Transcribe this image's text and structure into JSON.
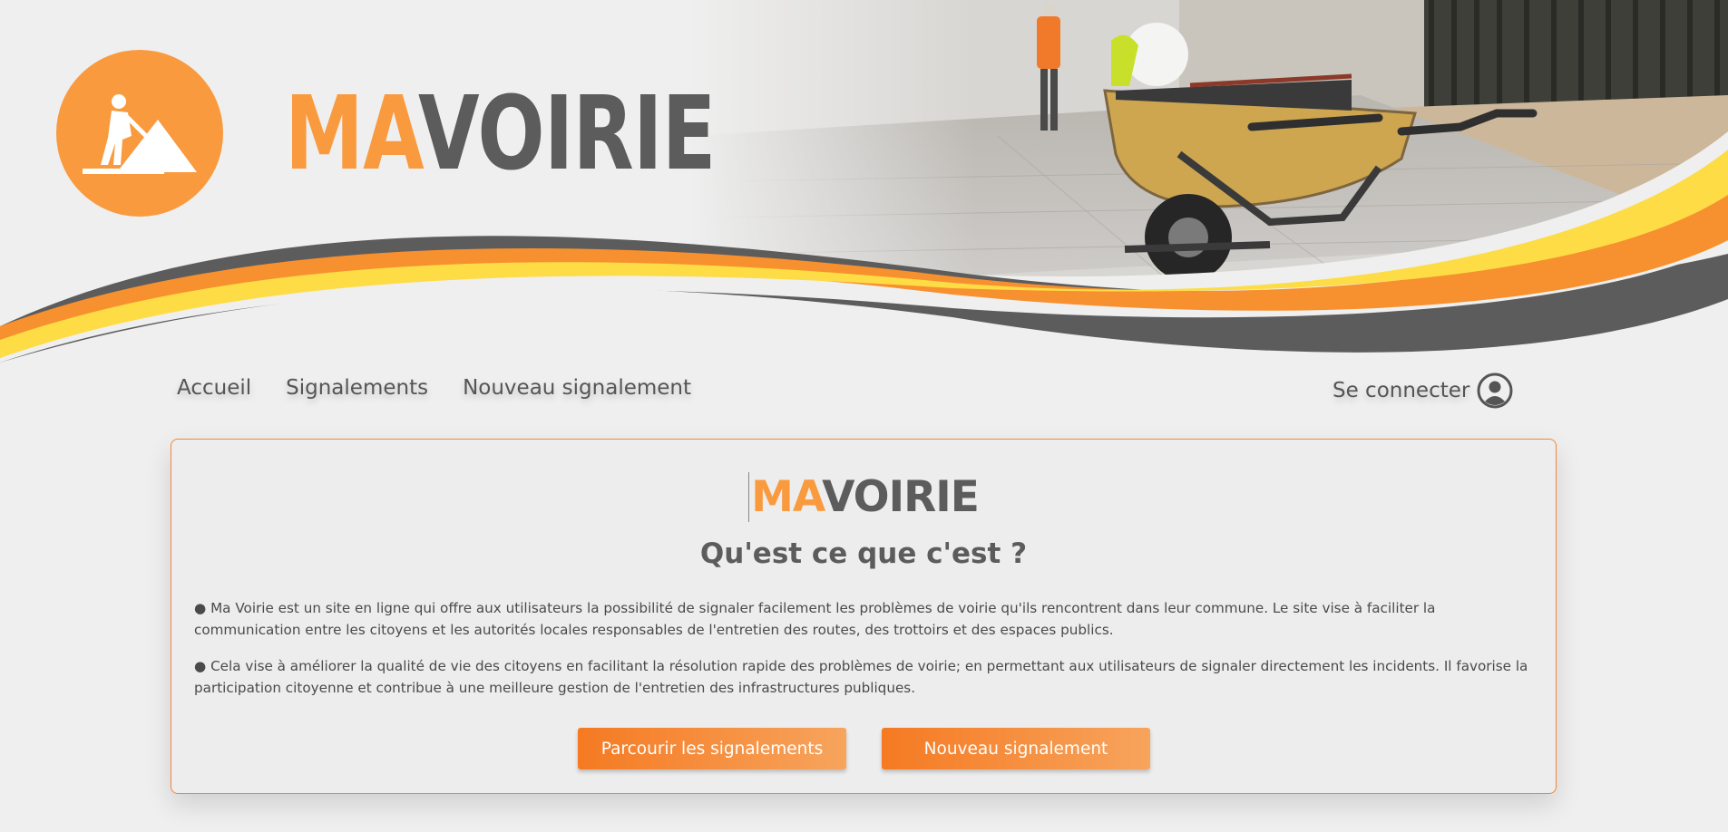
{
  "header": {
    "brand_ma": "MA",
    "brand_voirie": "VOIRIE",
    "logo_icon": "road-worker-icon",
    "hero_image": "wheelbarrow-photo",
    "colors": {
      "orange": "#f99a3e",
      "yellow": "#fddc45",
      "gray": "#5c5c5c"
    }
  },
  "nav": {
    "items": [
      {
        "label": "Accueil"
      },
      {
        "label": "Signalements"
      },
      {
        "label": "Nouveau signalement"
      }
    ],
    "login_label": "Se connecter",
    "login_icon": "user-circle-icon"
  },
  "card": {
    "brand_ma": "MA",
    "brand_voirie": "VOIRIE",
    "subtitle": "Qu'est ce que c'est ?",
    "paragraph1": "● Ma Voirie est un site en ligne qui offre aux utilisateurs la possibilité de signaler facilement les problèmes de voirie qu'ils rencontrent dans leur commune. Le site vise à faciliter la communication entre les citoyens et les autorités locales responsables de l'entretien des routes, des trottoirs et des espaces publics.",
    "paragraph2": "● Cela vise à améliorer la qualité de vie des citoyens en facilitant la résolution rapide des problèmes de voirie; en permettant aux utilisateurs de signaler directement les incidents. Il favorise la participation citoyenne et contribue à une meilleure gestion de l'entretien des infrastructures publiques.",
    "button_browse": "Parcourir les signalements",
    "button_new": "Nouveau signalement"
  }
}
